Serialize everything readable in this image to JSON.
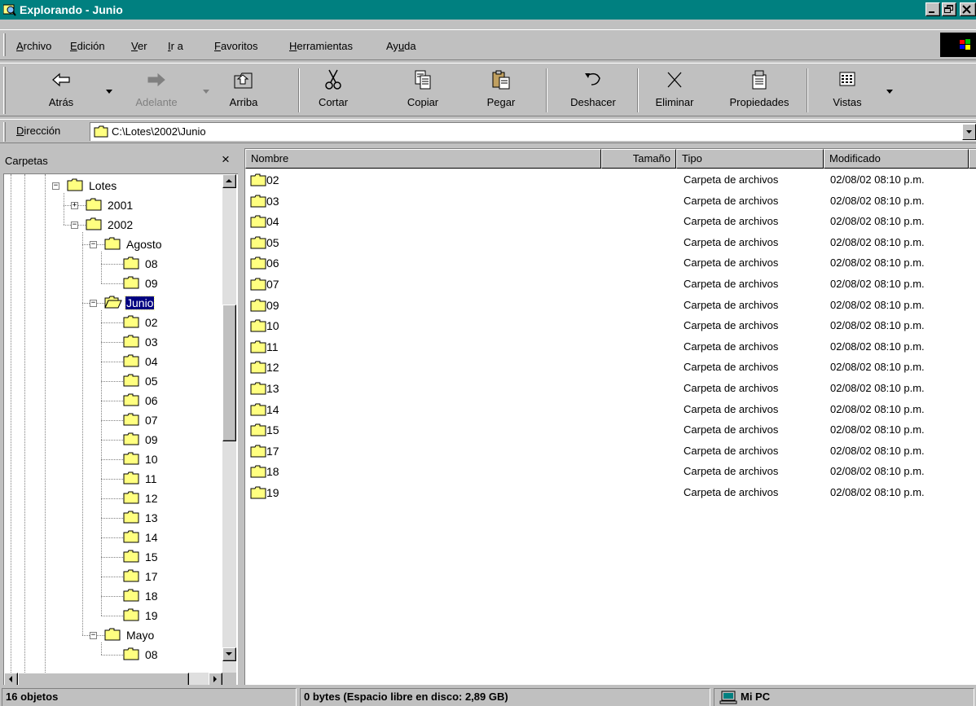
{
  "window": {
    "title": "Explorando - Junio"
  },
  "menu": {
    "items": [
      {
        "pre": "",
        "u": "A",
        "post": "rchivo"
      },
      {
        "pre": "",
        "u": "E",
        "post": "dición"
      },
      {
        "pre": "",
        "u": "V",
        "post": "er"
      },
      {
        "pre": "",
        "u": "I",
        "post": "r a"
      },
      {
        "pre": "",
        "u": "F",
        "post": "avoritos"
      },
      {
        "pre": "",
        "u": "H",
        "post": "erramientas"
      },
      {
        "pre": "Ay",
        "u": "u",
        "post": "da"
      }
    ]
  },
  "toolbar": {
    "back": "Atrás",
    "forward": "Adelante",
    "up": "Arriba",
    "cut": "Cortar",
    "copy": "Copiar",
    "paste": "Pegar",
    "undo": "Deshacer",
    "delete": "Eliminar",
    "properties": "Propiedades",
    "views": "Vistas"
  },
  "address": {
    "label_u": "D",
    "label_rest": "irección",
    "value": "C:\\Lotes\\2002\\Junio"
  },
  "folders_pane": {
    "title": "Carpetas",
    "close": "×",
    "tree": [
      {
        "label": "Lotes",
        "level": 0,
        "expander": "minus"
      },
      {
        "label": "2001",
        "level": 1,
        "expander": "plus"
      },
      {
        "label": "2002",
        "level": 1,
        "expander": "minus"
      },
      {
        "label": "Agosto",
        "level": 2,
        "expander": "minus"
      },
      {
        "label": "08",
        "level": 3,
        "expander": "none"
      },
      {
        "label": "09",
        "level": 3,
        "expander": "none"
      },
      {
        "label": "Junio",
        "level": 2,
        "expander": "minus",
        "selected": true,
        "open": true
      },
      {
        "label": "02",
        "level": 3,
        "expander": "none"
      },
      {
        "label": "03",
        "level": 3,
        "expander": "none"
      },
      {
        "label": "04",
        "level": 3,
        "expander": "none"
      },
      {
        "label": "05",
        "level": 3,
        "expander": "none"
      },
      {
        "label": "06",
        "level": 3,
        "expander": "none"
      },
      {
        "label": "07",
        "level": 3,
        "expander": "none"
      },
      {
        "label": "09",
        "level": 3,
        "expander": "none"
      },
      {
        "label": "10",
        "level": 3,
        "expander": "none"
      },
      {
        "label": "11",
        "level": 3,
        "expander": "none"
      },
      {
        "label": "12",
        "level": 3,
        "expander": "none"
      },
      {
        "label": "13",
        "level": 3,
        "expander": "none"
      },
      {
        "label": "14",
        "level": 3,
        "expander": "none"
      },
      {
        "label": "15",
        "level": 3,
        "expander": "none"
      },
      {
        "label": "17",
        "level": 3,
        "expander": "none"
      },
      {
        "label": "18",
        "level": 3,
        "expander": "none"
      },
      {
        "label": "19",
        "level": 3,
        "expander": "none"
      },
      {
        "label": "Mayo",
        "level": 2,
        "expander": "minus"
      },
      {
        "label": "08",
        "level": 3,
        "expander": "none"
      }
    ]
  },
  "file_list": {
    "columns": {
      "name": "Nombre",
      "size": "Tamaño",
      "type": "Tipo",
      "modified": "Modificado"
    },
    "rows": [
      {
        "name": "02",
        "size": "",
        "type": "Carpeta de archivos",
        "modified": "02/08/02 08:10 p.m."
      },
      {
        "name": "03",
        "size": "",
        "type": "Carpeta de archivos",
        "modified": "02/08/02 08:10 p.m."
      },
      {
        "name": "04",
        "size": "",
        "type": "Carpeta de archivos",
        "modified": "02/08/02 08:10 p.m."
      },
      {
        "name": "05",
        "size": "",
        "type": "Carpeta de archivos",
        "modified": "02/08/02 08:10 p.m."
      },
      {
        "name": "06",
        "size": "",
        "type": "Carpeta de archivos",
        "modified": "02/08/02 08:10 p.m."
      },
      {
        "name": "07",
        "size": "",
        "type": "Carpeta de archivos",
        "modified": "02/08/02 08:10 p.m."
      },
      {
        "name": "09",
        "size": "",
        "type": "Carpeta de archivos",
        "modified": "02/08/02 08:10 p.m."
      },
      {
        "name": "10",
        "size": "",
        "type": "Carpeta de archivos",
        "modified": "02/08/02 08:10 p.m."
      },
      {
        "name": "11",
        "size": "",
        "type": "Carpeta de archivos",
        "modified": "02/08/02 08:10 p.m."
      },
      {
        "name": "12",
        "size": "",
        "type": "Carpeta de archivos",
        "modified": "02/08/02 08:10 p.m."
      },
      {
        "name": "13",
        "size": "",
        "type": "Carpeta de archivos",
        "modified": "02/08/02 08:10 p.m."
      },
      {
        "name": "14",
        "size": "",
        "type": "Carpeta de archivos",
        "modified": "02/08/02 08:10 p.m."
      },
      {
        "name": "15",
        "size": "",
        "type": "Carpeta de archivos",
        "modified": "02/08/02 08:10 p.m."
      },
      {
        "name": "17",
        "size": "",
        "type": "Carpeta de archivos",
        "modified": "02/08/02 08:10 p.m."
      },
      {
        "name": "18",
        "size": "",
        "type": "Carpeta de archivos",
        "modified": "02/08/02 08:10 p.m."
      },
      {
        "name": "19",
        "size": "",
        "type": "Carpeta de archivos",
        "modified": "02/08/02 08:10 p.m."
      }
    ]
  },
  "status": {
    "count": "16 objetos",
    "space": "0 bytes (Espacio libre en disco: 2,89 GB)",
    "location": "Mi PC"
  },
  "colors": {
    "title_bar": "#008080",
    "face": "#c0c0c0",
    "selection": "#000080",
    "folder": "#ffff80"
  }
}
